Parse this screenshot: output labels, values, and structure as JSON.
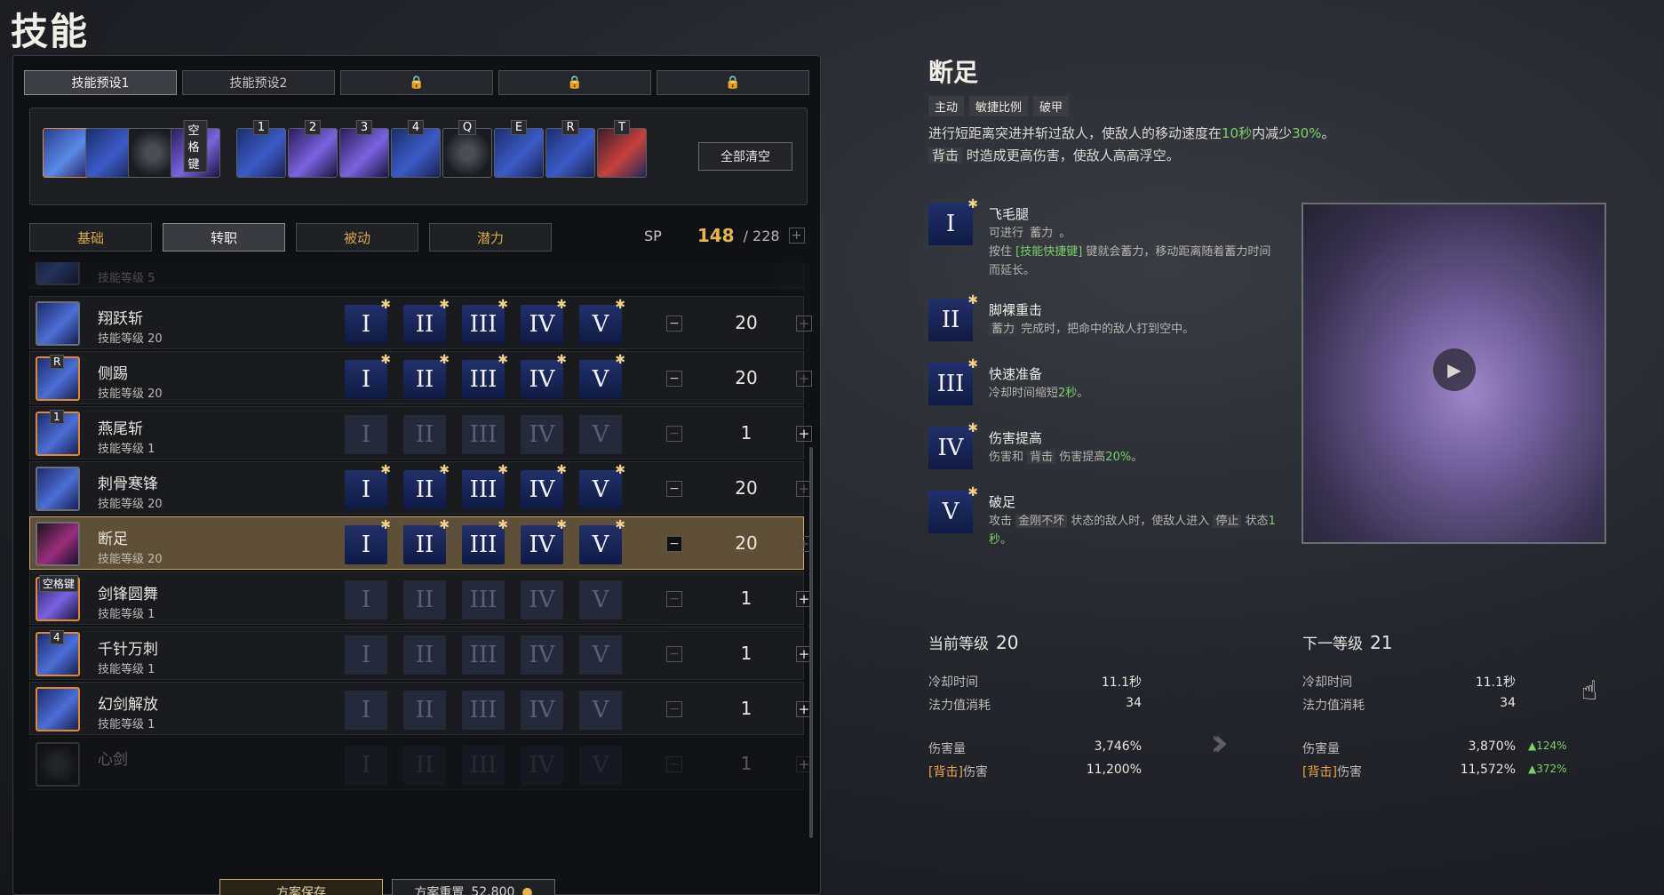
{
  "page_title": "技能",
  "presets": [
    {
      "label": "技能预设1",
      "state": "active"
    },
    {
      "label": "技能预设2",
      "state": "normal"
    },
    {
      "label": "",
      "state": "locked"
    },
    {
      "label": "",
      "state": "locked"
    },
    {
      "label": "",
      "state": "locked"
    }
  ],
  "slot_keys": {
    "space": "空格键",
    "k1": "1",
    "k2": "2",
    "k3": "3",
    "k4": "4",
    "q": "Q",
    "e": "E",
    "r": "R",
    "t": "T"
  },
  "clear_all": "全部清空",
  "categories": {
    "basic": "基础",
    "advance": "转职",
    "passive": "被动",
    "potential": "潜力"
  },
  "sp": {
    "label": "SP",
    "current": "148",
    "max": "/ 228"
  },
  "skills": [
    {
      "name": "",
      "level": "技能等级 5"
    },
    {
      "name": "翔跃斩",
      "level": "技能等级 20",
      "value": "20"
    },
    {
      "name": "侧踢",
      "level": "技能等级 20",
      "value": "20",
      "badge": "R"
    },
    {
      "name": "燕尾斩",
      "level": "技能等级 1",
      "value": "1",
      "badge": "1"
    },
    {
      "name": "刺骨寒锋",
      "level": "技能等级 20",
      "value": "20"
    },
    {
      "name": "断足",
      "level": "技能等级 20",
      "value": "20"
    },
    {
      "name": "剑锋圆舞",
      "level": "技能等级 1",
      "value": "1",
      "badge": "空格键"
    },
    {
      "name": "千针万刺",
      "level": "技能等级 1",
      "value": "1",
      "badge": "4"
    },
    {
      "name": "幻剑解放",
      "level": "技能等级 1",
      "value": "1"
    },
    {
      "name": "心剑",
      "level": "",
      "value": "1"
    }
  ],
  "tier_numerals": [
    "I",
    "II",
    "III",
    "IV",
    "V"
  ],
  "star": "✱",
  "minus": "−",
  "plus": "+",
  "bottom": {
    "save": "方案保存",
    "reset": "方案重置",
    "reset_cost": "52,800"
  },
  "detail": {
    "title": "断足",
    "tags": [
      "主动",
      "敏捷比例",
      "破甲"
    ],
    "desc_line1_a": "进行短距离突进并斩过敌人，使敌人的移动速度在",
    "desc_line1_b": "10秒",
    "desc_line1_c": "内减少",
    "desc_line1_d": "30%",
    "desc_line1_e": "。",
    "desc_line2_hl": "背击",
    "desc_line2": " 时造成更高伤害，使敌人高高浮空。",
    "perks": [
      {
        "numeral": "I",
        "name": "飞毛腿",
        "d1a": "可进行 ",
        "d1hl": "蓄力",
        "d1b": " 。",
        "d2a": "按住 ",
        "d2key": "[技能快捷键]",
        "d2b": " 键就会蓄力，移动距离随着蓄力时间而延长。"
      },
      {
        "numeral": "II",
        "name": "脚裸重击",
        "d1hl": "蓄力",
        "d1b": " 完成时，把命中的敌人打到空中。"
      },
      {
        "numeral": "III",
        "name": "快速准备",
        "d1a": "冷却时间缩短",
        "d1g": "2秒",
        "d1b": "。"
      },
      {
        "numeral": "IV",
        "name": "伤害提高",
        "d1a": "伤害和 ",
        "d1hl": "背击",
        "d1b": " 伤害提高",
        "d1g": "20%",
        "d1c": "。"
      },
      {
        "numeral": "V",
        "name": "破足",
        "d1a": "攻击 ",
        "d1hl": "金刚不坏",
        "d1b": " 状态的敌人时，使敌人进入 ",
        "d1hl2": "停止",
        "d1c": " 状态",
        "d1g": "1秒",
        "d1d": "。"
      }
    ]
  },
  "current": {
    "title": "当前等级",
    "level": "20",
    "cooldown_label": "冷却时间",
    "cooldown": "11.1秒",
    "mana_label": "法力值消耗",
    "mana": "34",
    "damage_label": "伤害量",
    "damage": "3,746%",
    "back_label_a": "[背击]",
    "back_label_b": "伤害",
    "back": "11,200%"
  },
  "next": {
    "title": "下一等级",
    "level": "21",
    "cooldown_label": "冷却时间",
    "cooldown": "11.1秒",
    "mana_label": "法力值消耗",
    "mana": "34",
    "damage_label": "伤害量",
    "damage": "3,870%",
    "damage_delta": "▲124%",
    "back_label_a": "[背击]",
    "back_label_b": "伤害",
    "back": "11,572%",
    "back_delta": "▲372%"
  }
}
